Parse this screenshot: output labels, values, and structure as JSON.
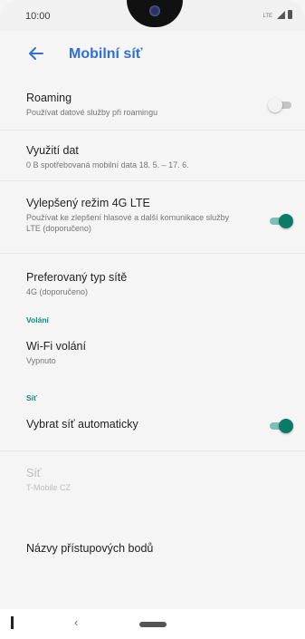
{
  "status_bar": {
    "time": "10:00",
    "network_label": "LTE"
  },
  "app_bar": {
    "title": "Mobilní síť"
  },
  "settings": {
    "roaming": {
      "title": "Roaming",
      "subtitle": "Používat datové služby při roamingu",
      "enabled": false
    },
    "data_usage": {
      "title": "Využití dat",
      "subtitle": "0 B spotřebovaná mobilní data 18. 5. – 17. 6."
    },
    "lte_mode": {
      "title": "Vylepšený režim 4G LTE",
      "subtitle": "Používat ke zlepšení hlasové a další komunikace služby LTE (doporučeno)",
      "enabled": true
    },
    "preferred_network": {
      "title": "Preferovaný typ sítě",
      "subtitle": "4G (doporučeno)"
    },
    "section_calls": "Volání",
    "wifi_calling": {
      "title": "Wi-Fi volání",
      "subtitle": "Vypnuto"
    },
    "section_network": "Síť",
    "auto_network": {
      "title": "Vybrat síť automaticky",
      "enabled": true
    },
    "network": {
      "title": "Síť",
      "subtitle": "T-Mobile CZ"
    },
    "apn": {
      "title": "Názvy přístupových bodů"
    }
  },
  "nav_bar": {
    "back_glyph": "‹"
  },
  "colors": {
    "accent_title": "#2f6fd6",
    "section_header": "#138a7a",
    "toggle_on": "#0b7a66"
  }
}
